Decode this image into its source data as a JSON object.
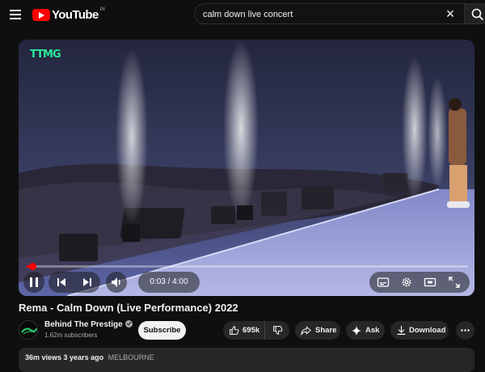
{
  "header": {
    "logo_text": "YouTube",
    "logo_country": "IN",
    "search_value": "calm down live concert",
    "icons": {
      "menu": "hamburger-menu-icon",
      "clear": "close-icon",
      "search": "search-icon"
    }
  },
  "player": {
    "channel_watermark": "TTMG",
    "time_current": "0:03",
    "time_separator": "/",
    "time_total": "4:00",
    "progress_fraction": 0.0125,
    "accent": "#ff0000"
  },
  "video": {
    "title": "Rema - Calm Down (Live Performance) 2022"
  },
  "channel": {
    "name": "Behind The Prestige",
    "subscribers": "1.62m subscribers",
    "subscribe_label": "Subscribe"
  },
  "actions": {
    "likes": "695k",
    "share_label": "Share",
    "ask_label": "Ask",
    "download_label": "Download"
  },
  "description": {
    "views": "36m views",
    "age": "3 years ago",
    "location": "MELBOURNE"
  }
}
